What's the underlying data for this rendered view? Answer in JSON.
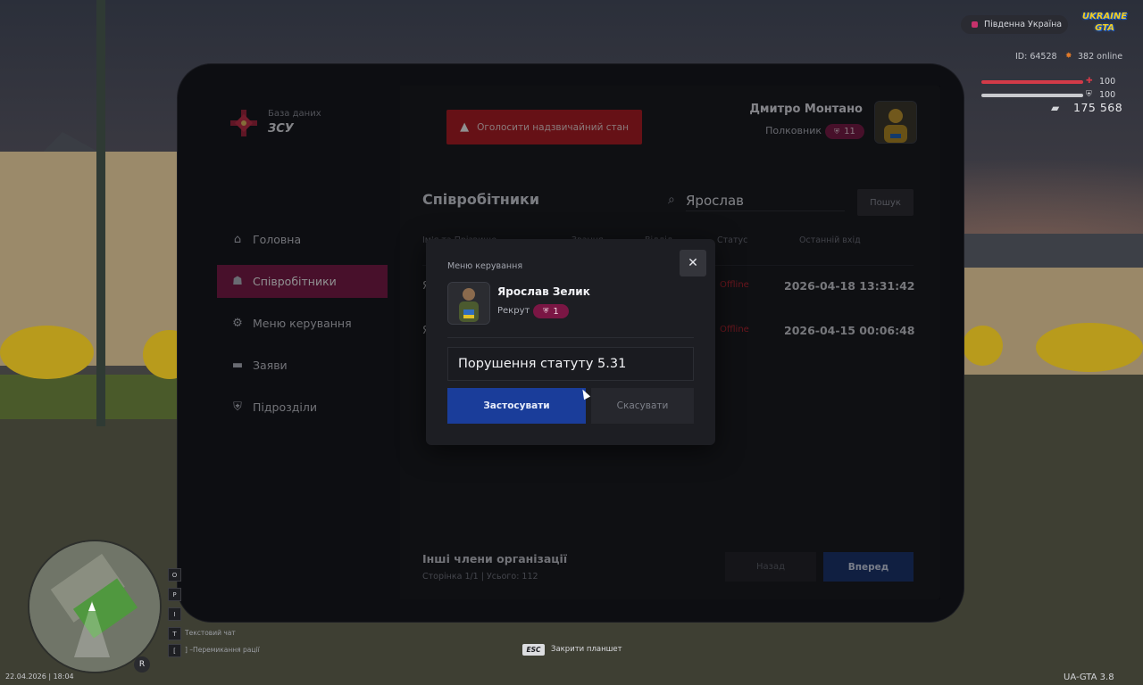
{
  "hud": {
    "server": "Південна Україна",
    "game_logo": "UKRAINE GTA",
    "player_id": "ID: 64528",
    "online": "382 online",
    "health": "100",
    "armor": "100",
    "money": "175 568",
    "esc_key": "ESC",
    "esc_hint": "Закрити планшет",
    "hint_keys": [
      "O",
      "P",
      "I",
      "T",
      "["
    ],
    "hint_chat": "Текстовий чат",
    "hint_switch": "]   –Перемикання рації",
    "date_time": "22.04.2026 | 18:04",
    "version": "UA-GTA 3.8",
    "minimap_marker": "R"
  },
  "tablet": {
    "logo_subtitle": "База даних",
    "logo_title": "ЗСУ",
    "nav": [
      {
        "label": "Головна",
        "icon": "home-icon",
        "active": false
      },
      {
        "label": "Співробітники",
        "icon": "users-icon",
        "active": true
      },
      {
        "label": "Меню керування",
        "icon": "gear-icon",
        "active": false
      },
      {
        "label": "Заяви",
        "icon": "folder-icon",
        "active": false
      },
      {
        "label": "Підрозділи",
        "icon": "shield-icon",
        "active": false
      }
    ],
    "alert_button": "Оголосити надзвичайний стан",
    "user": {
      "name": "Дмитро Монтано",
      "rank": "Полковник",
      "level": "11"
    },
    "section_title": "Співробітники",
    "search": {
      "value": "Ярослав",
      "button": "Пошук"
    },
    "table": {
      "headers": [
        "Ім'я та Прізвище",
        "Звання",
        "Відділ",
        "Статус",
        "Останній вхід"
      ],
      "rows": [
        {
          "name": "Я",
          "status": "Offline",
          "last_login": "2026-04-18 13:31:42"
        },
        {
          "name": "Я",
          "status": "Offline",
          "last_login": "2026-04-15 00:06:48"
        }
      ]
    },
    "footer": {
      "title": "Інші члени організації",
      "pagination": "Сторінка 1/1 | Усього: 112",
      "back": "Назад",
      "next": "Вперед"
    }
  },
  "modal": {
    "title": "Меню керування",
    "close": "✕",
    "member": {
      "name": "Ярослав Зелик",
      "rank": "Рекрут",
      "level": "1"
    },
    "reason_value": "Порушення статуту 5.31",
    "apply": "Застосувати",
    "cancel": "Скасувати"
  },
  "colors": {
    "accent_active": "#7c1646",
    "alert": "#b3191f",
    "primary": "#1a3d9a",
    "offline": "#b8212c",
    "health": "#d23a48"
  }
}
